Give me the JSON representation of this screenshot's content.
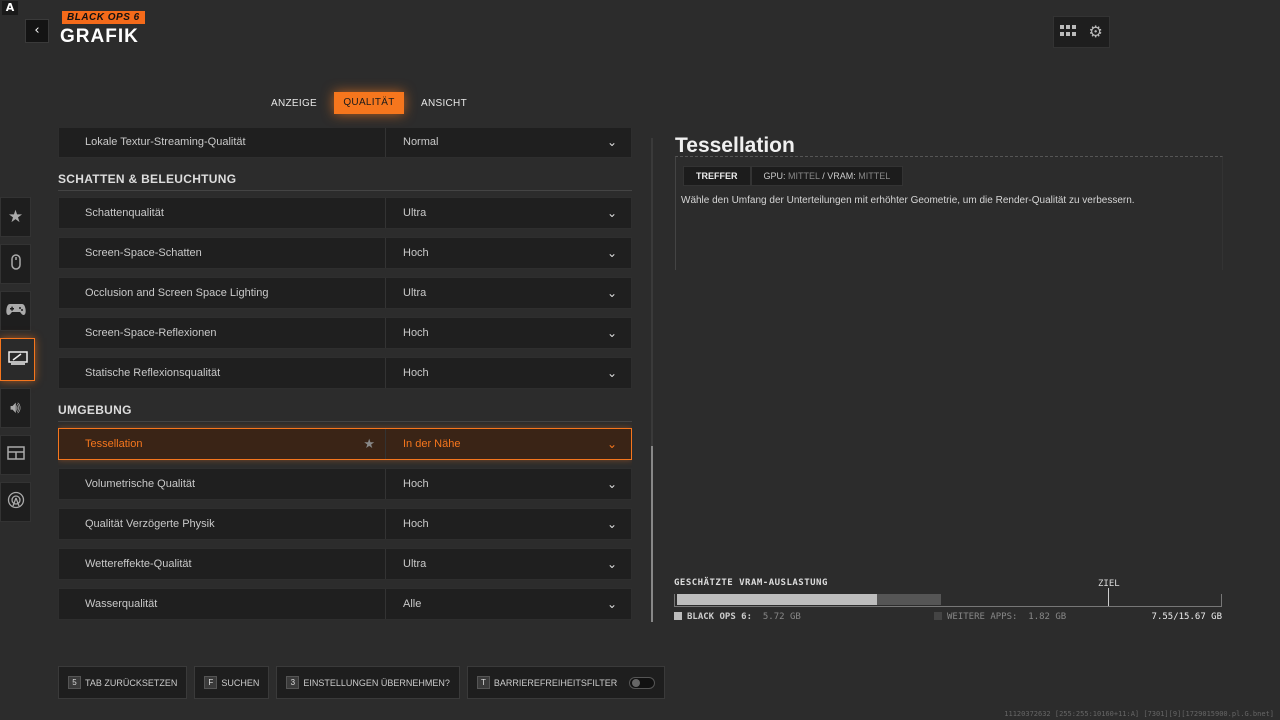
{
  "header": {
    "back_icon": "chevron-left-icon",
    "brand": "BLACK OPS 6",
    "title": "GRAFIK",
    "icons": [
      "grid-icon",
      "gear-icon"
    ]
  },
  "tabs": [
    {
      "label": "ANZEIGE",
      "active": false
    },
    {
      "label": "QUALITÄT",
      "active": true
    },
    {
      "label": "ANSICHT",
      "active": false
    }
  ],
  "side_nav": [
    {
      "icon": "star-icon",
      "active": false
    },
    {
      "icon": "mouse-icon",
      "active": false
    },
    {
      "icon": "controller-icon",
      "active": false
    },
    {
      "icon": "display-icon",
      "active": true
    },
    {
      "icon": "speaker-icon",
      "active": false
    },
    {
      "icon": "interface-icon",
      "active": false
    },
    {
      "icon": "network-icon",
      "active": false
    }
  ],
  "settings": {
    "top_row": {
      "label": "Lokale Textur-Streaming-Qualität",
      "value": "Normal"
    },
    "section_shadows": "SCHATTEN & BELEUCHTUNG",
    "shadows": [
      {
        "label": "Schattenqualität",
        "value": "Ultra"
      },
      {
        "label": "Screen-Space-Schatten",
        "value": "Hoch"
      },
      {
        "label": "Occlusion and Screen Space Lighting",
        "value": "Ultra"
      },
      {
        "label": "Screen-Space-Reflexionen",
        "value": "Hoch"
      },
      {
        "label": "Statische Reflexionsqualität",
        "value": "Hoch"
      }
    ],
    "section_env": "UMGEBUNG",
    "env": [
      {
        "label": "Tessellation",
        "value": "In der Nähe",
        "active": true
      },
      {
        "label": "Volumetrische Qualität",
        "value": "Hoch"
      },
      {
        "label": "Qualität Verzögerte Physik",
        "value": "Hoch"
      },
      {
        "label": "Wettereffekte-Qualität",
        "value": "Ultra"
      },
      {
        "label": "Wasserqualität",
        "value": "Alle"
      }
    ]
  },
  "detail": {
    "title": "Tessellation",
    "chip_treffer": "TREFFER",
    "chip_gpu_label": "GPU:",
    "chip_gpu_value": "MITTEL",
    "chip_sep": "/",
    "chip_vram_label": "VRAM:",
    "chip_vram_value": "MITTEL",
    "description": "Wähle den Umfang der Unterteilungen mit erhöhter Geometrie, um die Render-Qualität zu verbessern."
  },
  "vram": {
    "title": "GESCHÄTZTE VRAM-AUSLASTUNG",
    "target_label": "ZIEL",
    "bo_label": "BLACK OPS 6:",
    "bo_value": "5.72 GB",
    "other_label": "WEITERE APPS:",
    "other_value": "1.82 GB",
    "total": "7.55/15.67 GB",
    "bo_fraction": 0.365,
    "other_fraction": 0.116,
    "target_fraction": 0.79,
    "bo_color": "#bdbdbd",
    "other_color": "#555555"
  },
  "bottom_bar": [
    {
      "key": "5",
      "label": "TAB ZURÜCKSETZEN"
    },
    {
      "key": "F",
      "label": "SUCHEN"
    },
    {
      "key": "3",
      "label": "EINSTELLUNGEN ÜBERNEHMEN?"
    },
    {
      "key": "T",
      "label": "BARRIEREFREIHEITSFILTER",
      "toggle": false
    }
  ],
  "footer_code": "11120372632 [255:255:10160+11:A] [7301][9][1729015900.pl.G.bnet]",
  "accent_color": "#f6761d"
}
